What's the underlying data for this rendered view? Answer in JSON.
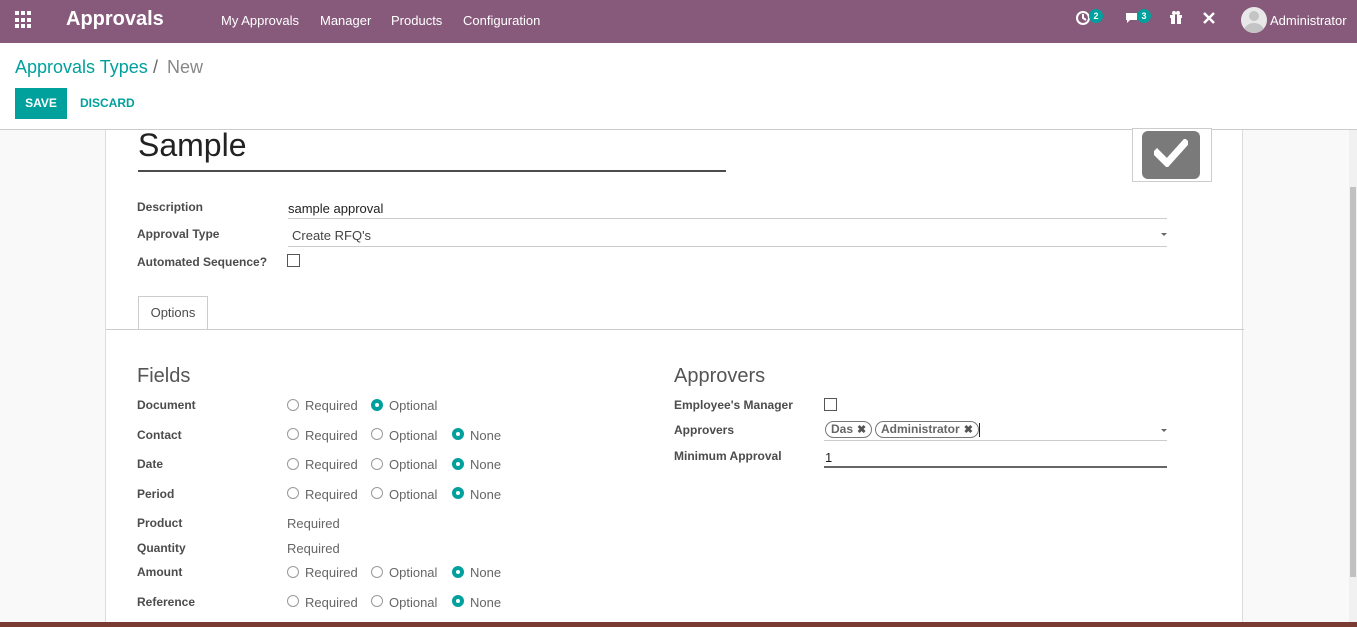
{
  "navbar": {
    "brand": "Approvals",
    "menu": [
      "My Approvals",
      "Manager",
      "Products",
      "Configuration"
    ],
    "activity_count": "2",
    "message_count": "3",
    "user": "Administrator"
  },
  "breadcrumb": {
    "parent": "Approvals Types",
    "separator": "/",
    "current": "New"
  },
  "buttons": {
    "save": "SAVE",
    "discard": "DISCARD"
  },
  "record": {
    "name": "Sample",
    "description_label": "Description",
    "description_value": "sample approval",
    "type_label": "Approval Type",
    "type_value": "Create RFQ's",
    "auto_seq_label": "Automated Sequence?"
  },
  "tabs": [
    "Options"
  ],
  "fields": {
    "heading": "Fields",
    "rows": [
      {
        "label": "Document",
        "options": [
          "Required",
          "Optional"
        ],
        "selected": "Optional"
      },
      {
        "label": "Contact",
        "options": [
          "Required",
          "Optional",
          "None"
        ],
        "selected": "None"
      },
      {
        "label": "Date",
        "options": [
          "Required",
          "Optional",
          "None"
        ],
        "selected": "None"
      },
      {
        "label": "Period",
        "options": [
          "Required",
          "Optional",
          "None"
        ],
        "selected": "None"
      },
      {
        "label": "Product",
        "static": "Required"
      },
      {
        "label": "Quantity",
        "static": "Required"
      },
      {
        "label": "Amount",
        "options": [
          "Required",
          "Optional",
          "None"
        ],
        "selected": "None"
      },
      {
        "label": "Reference",
        "options": [
          "Required",
          "Optional",
          "None"
        ],
        "selected": "None"
      }
    ]
  },
  "approvers": {
    "heading": "Approvers",
    "manager_label": "Employee's Manager",
    "approvers_label": "Approvers",
    "tags": [
      "Das",
      "Administrator"
    ],
    "min_label": "Minimum Approval",
    "min_value": "1"
  },
  "colors": {
    "navbar": "#875a7b",
    "accent": "#00a09d"
  }
}
